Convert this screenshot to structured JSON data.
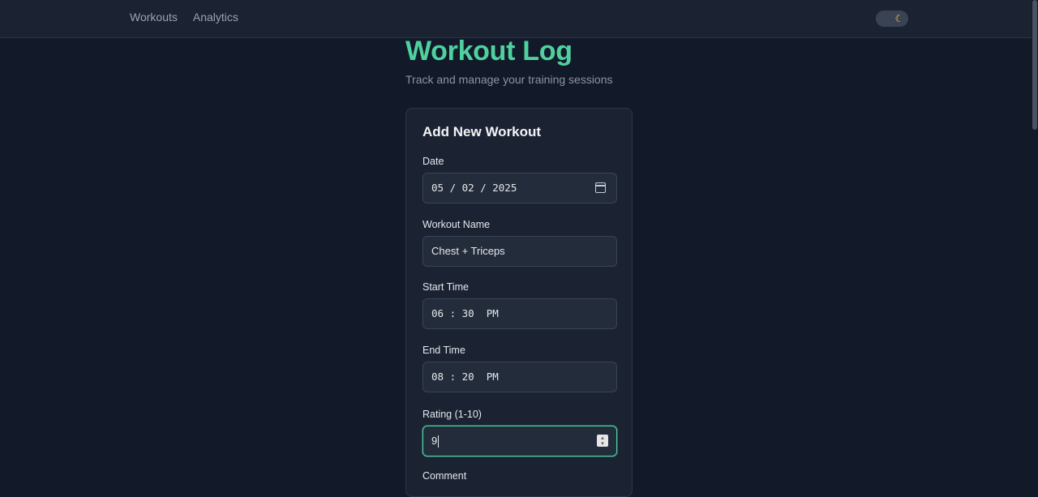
{
  "nav": {
    "links": [
      "Workouts",
      "Analytics"
    ],
    "theme_icon": "moon-icon"
  },
  "page": {
    "title": "Workout Log",
    "subtitle": "Track and manage your training sessions"
  },
  "form": {
    "title": "Add New Workout",
    "date": {
      "label": "Date",
      "value": "05 / 02 / 2025",
      "icon": "calendar-icon"
    },
    "name": {
      "label": "Workout Name",
      "value": "Chest + Triceps"
    },
    "start": {
      "label": "Start Time",
      "value": "06 : 30  PM"
    },
    "end": {
      "label": "End Time",
      "value": "08 : 20  PM"
    },
    "rating": {
      "label": "Rating (1-10)",
      "value": "9",
      "icon": "spinner-icon"
    },
    "comment": {
      "label": "Comment"
    }
  },
  "colors": {
    "accent": "#4fd19e",
    "background": "#121a2a",
    "card": "#1b2333"
  }
}
